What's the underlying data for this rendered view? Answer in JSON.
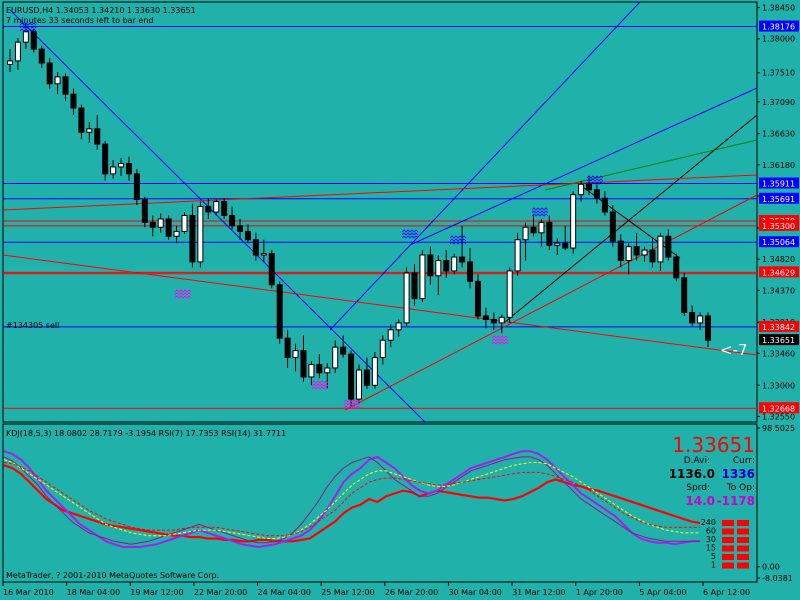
{
  "window": {
    "symbol_line": "EURUSD,H4  1.34053 1.34210 1.33630 1.33651",
    "timer_line": "7 minutes 33 seconds left to bar end",
    "order_label": "#134305 sell",
    "copyright": "MetaTrader, ? 2001-2010 MetaQuotes Software Corp.",
    "pointer_text": "<-7"
  },
  "colors": {
    "background": "#20b2aa",
    "candle_up": "#ffffff",
    "candle_down": "#000000",
    "blue_line": "#0000ff",
    "red_line": "#ff0000",
    "green_line": "#008000",
    "black_line": "#000000",
    "rsi14": "#ff0000",
    "rsi7": "#a020f0",
    "kdj": "#8b1a8b",
    "dashed_yellow": "#ffff00",
    "current_price_tag": "#000000"
  },
  "chart_data": [
    {
      "type": "candlestick",
      "symbol": "EURUSD",
      "timeframe": "H4",
      "ohlc_header": {
        "open": 1.34053,
        "high": 1.3421,
        "low": 1.3363,
        "close": 1.33651
      },
      "x_ticks": [
        "16 Mar 2010",
        "18 Mar 04:00",
        "19 Mar 12:00",
        "22 Mar 20:00",
        "24 Mar 04:00",
        "25 Mar 12:00",
        "26 Mar 20:00",
        "30 Mar 04:00",
        "31 Mar 12:00",
        "1 Apr 20:00",
        "5 Apr 04:00",
        "6 Apr 12:00"
      ],
      "y_ticks": [
        "1.38450",
        "1.38000",
        "1.37510",
        "1.37090",
        "1.36630",
        "1.36180",
        "1.35730",
        "1.35270",
        "1.34820",
        "1.34370",
        "1.33910",
        "1.33460",
        "1.33000",
        "1.32550"
      ],
      "ylim": [
        1.3247,
        1.3853
      ],
      "candles": [
        [
          1.3763,
          1.3785,
          1.3752,
          1.3768
        ],
        [
          1.3768,
          1.3801,
          1.3755,
          1.3795
        ],
        [
          1.3795,
          1.3822,
          1.3785,
          1.381
        ],
        [
          1.381,
          1.3815,
          1.378,
          1.3785
        ],
        [
          1.3785,
          1.379,
          1.3758,
          1.3765
        ],
        [
          1.3765,
          1.3772,
          1.3728,
          1.3735
        ],
        [
          1.3735,
          1.3752,
          1.372,
          1.3745
        ],
        [
          1.3745,
          1.375,
          1.371,
          1.372
        ],
        [
          1.372,
          1.3728,
          1.369,
          1.37
        ],
        [
          1.37,
          1.3705,
          1.3655,
          1.3665
        ],
        [
          1.3665,
          1.368,
          1.365,
          1.367
        ],
        [
          1.367,
          1.369,
          1.364,
          1.3648
        ],
        [
          1.3648,
          1.3652,
          1.3595,
          1.3605
        ],
        [
          1.3605,
          1.3625,
          1.3598,
          1.3615
        ],
        [
          1.3615,
          1.3628,
          1.3602,
          1.362
        ],
        [
          1.362,
          1.363,
          1.3595,
          1.3605
        ],
        [
          1.3605,
          1.3612,
          1.356,
          1.3568
        ],
        [
          1.3568,
          1.3572,
          1.3528,
          1.3535
        ],
        [
          1.3535,
          1.3545,
          1.3515,
          1.3528
        ],
        [
          1.3528,
          1.3548,
          1.352,
          1.354
        ],
        [
          1.354,
          1.3545,
          1.351,
          1.3515
        ],
        [
          1.3515,
          1.353,
          1.3505,
          1.3522
        ],
        [
          1.3522,
          1.355,
          1.3518,
          1.3545
        ],
        [
          1.3545,
          1.3562,
          1.347,
          1.3478
        ],
        [
          1.3478,
          1.3565,
          1.347,
          1.3558
        ],
        [
          1.3558,
          1.357,
          1.354,
          1.355
        ],
        [
          1.355,
          1.3568,
          1.3545,
          1.3565
        ],
        [
          1.3565,
          1.357,
          1.354,
          1.3545
        ],
        [
          1.3545,
          1.3558,
          1.3525,
          1.353
        ],
        [
          1.353,
          1.354,
          1.351,
          1.3522
        ],
        [
          1.3522,
          1.3532,
          1.3505,
          1.351
        ],
        [
          1.351,
          1.352,
          1.348,
          1.3488
        ],
        [
          1.3488,
          1.351,
          1.3478,
          1.349
        ],
        [
          1.349,
          1.3495,
          1.344,
          1.3445
        ],
        [
          1.3445,
          1.345,
          1.336,
          1.3368
        ],
        [
          1.3368,
          1.338,
          1.3325,
          1.334
        ],
        [
          1.334,
          1.336,
          1.332,
          1.335
        ],
        [
          1.335,
          1.3372,
          1.3305,
          1.3312
        ],
        [
          1.3312,
          1.3335,
          1.33,
          1.333
        ],
        [
          1.333,
          1.3345,
          1.331,
          1.3318
        ],
        [
          1.3318,
          1.3332,
          1.3295,
          1.3325
        ],
        [
          1.3325,
          1.3365,
          1.3318,
          1.3355
        ],
        [
          1.3355,
          1.3372,
          1.334,
          1.3345
        ],
        [
          1.3345,
          1.335,
          1.327,
          1.328
        ],
        [
          1.328,
          1.333,
          1.3275,
          1.3322
        ],
        [
          1.3322,
          1.334,
          1.3295,
          1.33
        ],
        [
          1.33,
          1.3348,
          1.3295,
          1.334
        ],
        [
          1.334,
          1.3372,
          1.333,
          1.3365
        ],
        [
          1.3365,
          1.3388,
          1.3355,
          1.338
        ],
        [
          1.338,
          1.3395,
          1.337,
          1.339
        ],
        [
          1.339,
          1.347,
          1.3385,
          1.3462
        ],
        [
          1.3462,
          1.3475,
          1.3415,
          1.3425
        ],
        [
          1.3425,
          1.3495,
          1.342,
          1.3488
        ],
        [
          1.3488,
          1.35,
          1.3445,
          1.3458
        ],
        [
          1.3458,
          1.3488,
          1.343,
          1.348
        ],
        [
          1.348,
          1.3495,
          1.3455,
          1.3465
        ],
        [
          1.3465,
          1.349,
          1.346,
          1.3485
        ],
        [
          1.3485,
          1.353,
          1.347,
          1.3478
        ],
        [
          1.3478,
          1.3498,
          1.344,
          1.345
        ],
        [
          1.345,
          1.346,
          1.3395,
          1.34
        ],
        [
          1.34,
          1.3412,
          1.3382,
          1.3395
        ],
        [
          1.3395,
          1.3405,
          1.338,
          1.339
        ],
        [
          1.339,
          1.3402,
          1.3375,
          1.3398
        ],
        [
          1.3398,
          1.347,
          1.339,
          1.3465
        ],
        [
          1.3465,
          1.352,
          1.3458,
          1.351
        ],
        [
          1.351,
          1.3535,
          1.348,
          1.3528
        ],
        [
          1.3528,
          1.3545,
          1.3515,
          1.352
        ],
        [
          1.352,
          1.354,
          1.35,
          1.3535
        ],
        [
          1.3535,
          1.3545,
          1.3495,
          1.3502
        ],
        [
          1.3502,
          1.3512,
          1.3488,
          1.3505
        ],
        [
          1.3505,
          1.353,
          1.3495,
          1.3498
        ],
        [
          1.3498,
          1.358,
          1.349,
          1.3575
        ],
        [
          1.3575,
          1.3595,
          1.3565,
          1.359
        ],
        [
          1.359,
          1.36,
          1.3575,
          1.3582
        ],
        [
          1.3582,
          1.359,
          1.3562,
          1.357
        ],
        [
          1.357,
          1.358,
          1.3545,
          1.355
        ],
        [
          1.355,
          1.356,
          1.35,
          1.3508
        ],
        [
          1.3508,
          1.3518,
          1.347,
          1.348
        ],
        [
          1.348,
          1.3505,
          1.346,
          1.35
        ],
        [
          1.35,
          1.352,
          1.348,
          1.3488
        ],
        [
          1.3488,
          1.35,
          1.3478,
          1.3495
        ],
        [
          1.3495,
          1.3512,
          1.347,
          1.3478
        ],
        [
          1.3478,
          1.352,
          1.3465,
          1.3515
        ],
        [
          1.3515,
          1.3525,
          1.348,
          1.3485
        ],
        [
          1.3485,
          1.349,
          1.345,
          1.3455
        ],
        [
          1.3455,
          1.3462,
          1.34,
          1.3405
        ],
        [
          1.3405,
          1.3415,
          1.3385,
          1.339
        ],
        [
          1.339,
          1.3405,
          1.338,
          1.34
        ],
        [
          1.34,
          1.3405,
          1.3355,
          1.3365
        ]
      ],
      "price_tags": [
        {
          "label": "1.38450",
          "value": 1.3845,
          "color": "#ffffff",
          "bg": "#20b2aa"
        },
        {
          "label": "1.38176",
          "value": 1.38176,
          "color": "#ffffff",
          "bg": "#0000ff"
        },
        {
          "label": "1.35911",
          "value": 1.35911,
          "color": "#ffffff",
          "bg": "#0000ff"
        },
        {
          "label": "1.35691",
          "value": 1.35691,
          "color": "#ffffff",
          "bg": "#0000ff"
        },
        {
          "label": "1.35370",
          "value": 1.3537,
          "color": "#ffffff",
          "bg": "#ff0000"
        },
        {
          "label": "1.35300",
          "value": 1.353,
          "color": "#ffffff",
          "bg": "#ff0000"
        },
        {
          "label": "1.35064",
          "value": 1.35064,
          "color": "#ffffff",
          "bg": "#0000ff"
        },
        {
          "label": "1.34629",
          "value": 1.34629,
          "color": "#ffffff",
          "bg": "#ff0000"
        },
        {
          "label": "1.33842",
          "value": 1.33842,
          "color": "#ffffff",
          "bg": "#ff0000"
        },
        {
          "label": "1.33651",
          "value": 1.33651,
          "color": "#ffffff",
          "bg": "#000000"
        },
        {
          "label": "1.32668",
          "value": 1.32668,
          "color": "#ffffff",
          "bg": "#ff0000"
        }
      ],
      "horizontal_lines": [
        {
          "value": 1.38176,
          "color": "#0000ff"
        },
        {
          "value": 1.35911,
          "color": "#0000ff"
        },
        {
          "value": 1.35691,
          "color": "#0000ff"
        },
        {
          "value": 1.3537,
          "color": "#ff0000"
        },
        {
          "value": 1.353,
          "color": "#ff0000"
        },
        {
          "value": 1.35064,
          "color": "#0000ff"
        },
        {
          "value": 1.34629,
          "color": "#ff0000"
        },
        {
          "value": 1.34609,
          "color": "#ff0000"
        },
        {
          "value": 1.33842,
          "color": "#0000ff"
        },
        {
          "value": 1.32668,
          "color": "#ff0000"
        }
      ]
    },
    {
      "type": "line",
      "title": "KDJ(18,5,3) 18.0802 28.7179 -3.1954  RSI(7) 17.7353  RSI(14) 31.7711",
      "ylim": [
        -8.0381,
        98.5025
      ],
      "y_ticks": [
        "98.5025",
        "0.00",
        "-8.0381"
      ],
      "series": [
        {
          "name": "RSI(14)",
          "color": "#ff0000",
          "values": [
            72,
            70,
            66,
            60,
            54,
            48,
            44,
            40,
            38,
            36,
            34,
            32,
            30,
            29,
            28,
            27,
            26,
            25,
            24,
            23,
            22,
            22,
            21,
            21,
            20,
            20,
            19,
            19,
            18,
            18,
            19,
            19,
            18,
            18,
            18,
            19,
            20,
            24,
            28,
            32,
            38,
            42,
            44,
            48,
            46,
            50,
            52,
            54,
            53,
            50,
            52,
            54,
            53,
            52,
            51,
            50,
            49,
            49,
            48,
            47,
            48,
            50,
            53,
            56,
            60,
            62,
            60,
            58,
            57,
            55,
            54,
            52,
            50,
            48,
            46,
            44,
            42,
            40,
            38,
            36,
            34,
            32,
            31
          ]
        },
        {
          "name": "RSI(7)",
          "color": "#a020f0",
          "values": [
            82,
            80,
            76,
            70,
            62,
            54,
            48,
            42,
            36,
            30,
            26,
            22,
            18,
            16,
            14,
            14,
            14,
            15,
            16,
            18,
            20,
            22,
            24,
            26,
            24,
            22,
            20,
            18,
            16,
            15,
            14,
            15,
            16,
            18,
            20,
            22,
            26,
            32,
            40,
            50,
            60,
            66,
            70,
            76,
            78,
            74,
            70,
            64,
            58,
            54,
            52,
            54,
            58,
            62,
            66,
            70,
            72,
            74,
            76,
            78,
            80,
            82,
            82,
            80,
            76,
            70,
            64,
            58,
            52,
            48,
            44,
            40,
            36,
            30,
            24,
            20,
            18,
            17,
            17,
            16,
            17,
            18,
            18
          ]
        },
        {
          "name": "KDJ K",
          "color": "#8b1a8b",
          "values": [
            78,
            75,
            70,
            64,
            58,
            50,
            44,
            38,
            32,
            28,
            24,
            22,
            20,
            18,
            17,
            16,
            17,
            18,
            20,
            22,
            24,
            26,
            28,
            30,
            28,
            26,
            24,
            22,
            20,
            18,
            17,
            17,
            18,
            20,
            24,
            30,
            38,
            46,
            56,
            64,
            70,
            74,
            76,
            78,
            74,
            68,
            62,
            58,
            54,
            50,
            50,
            52,
            56,
            60,
            64,
            68,
            70,
            72,
            74,
            76,
            77,
            78,
            78,
            76,
            72,
            66,
            60,
            54,
            48,
            44,
            40,
            36,
            32,
            28,
            24,
            22,
            20,
            19,
            18,
            18,
            18,
            18,
            18
          ]
        },
        {
          "name": "KDJ D",
          "color": "#ffff00",
          "dashed": true,
          "values": [
            76,
            74,
            70,
            66,
            62,
            58,
            54,
            50,
            46,
            42,
            38,
            34,
            30,
            28,
            26,
            24,
            23,
            22,
            22,
            22,
            23,
            24,
            25,
            26,
            26,
            26,
            25,
            24,
            23,
            22,
            21,
            20,
            20,
            21,
            23,
            26,
            30,
            35,
            40,
            46,
            52,
            58,
            62,
            66,
            68,
            68,
            66,
            64,
            62,
            60,
            58,
            57,
            57,
            58,
            60,
            62,
            64,
            66,
            68,
            70,
            72,
            73,
            74,
            74,
            73,
            70,
            67,
            64,
            60,
            56,
            52,
            48,
            44,
            40,
            36,
            33,
            30,
            28,
            26,
            25,
            24,
            24,
            24
          ]
        },
        {
          "name": "KDJ J",
          "color": "#ff0000",
          "dashed": true,
          "values": [
            74,
            73,
            71,
            68,
            64,
            60,
            56,
            52,
            48,
            44,
            40,
            37,
            34,
            32,
            30,
            28,
            27,
            26,
            26,
            26,
            26,
            27,
            28,
            28,
            28,
            28,
            27,
            26,
            25,
            24,
            23,
            22,
            22,
            22,
            23,
            25,
            28,
            32,
            36,
            40,
            46,
            52,
            56,
            60,
            62,
            63,
            63,
            62,
            61,
            60,
            59,
            58,
            58,
            59,
            60,
            61,
            62,
            63,
            64,
            65,
            66,
            67,
            67,
            67,
            66,
            64,
            62,
            60,
            57,
            54,
            50,
            46,
            42,
            38,
            35,
            32,
            30,
            29,
            28,
            28,
            28,
            28,
            28
          ]
        }
      ],
      "level_labels": [
        "240",
        "60",
        "30",
        "15",
        "5",
        "1"
      ]
    }
  ],
  "panel": {
    "price": "1.33651",
    "davi_label": "D.Avi:",
    "curr_label": "Curr:",
    "davi_value": "1136.0",
    "curr_value": "1336",
    "sprd_label": "Sprd:",
    "toop_label": "To Op:",
    "sprd_value": "14.0",
    "toop_value": "-1178"
  }
}
